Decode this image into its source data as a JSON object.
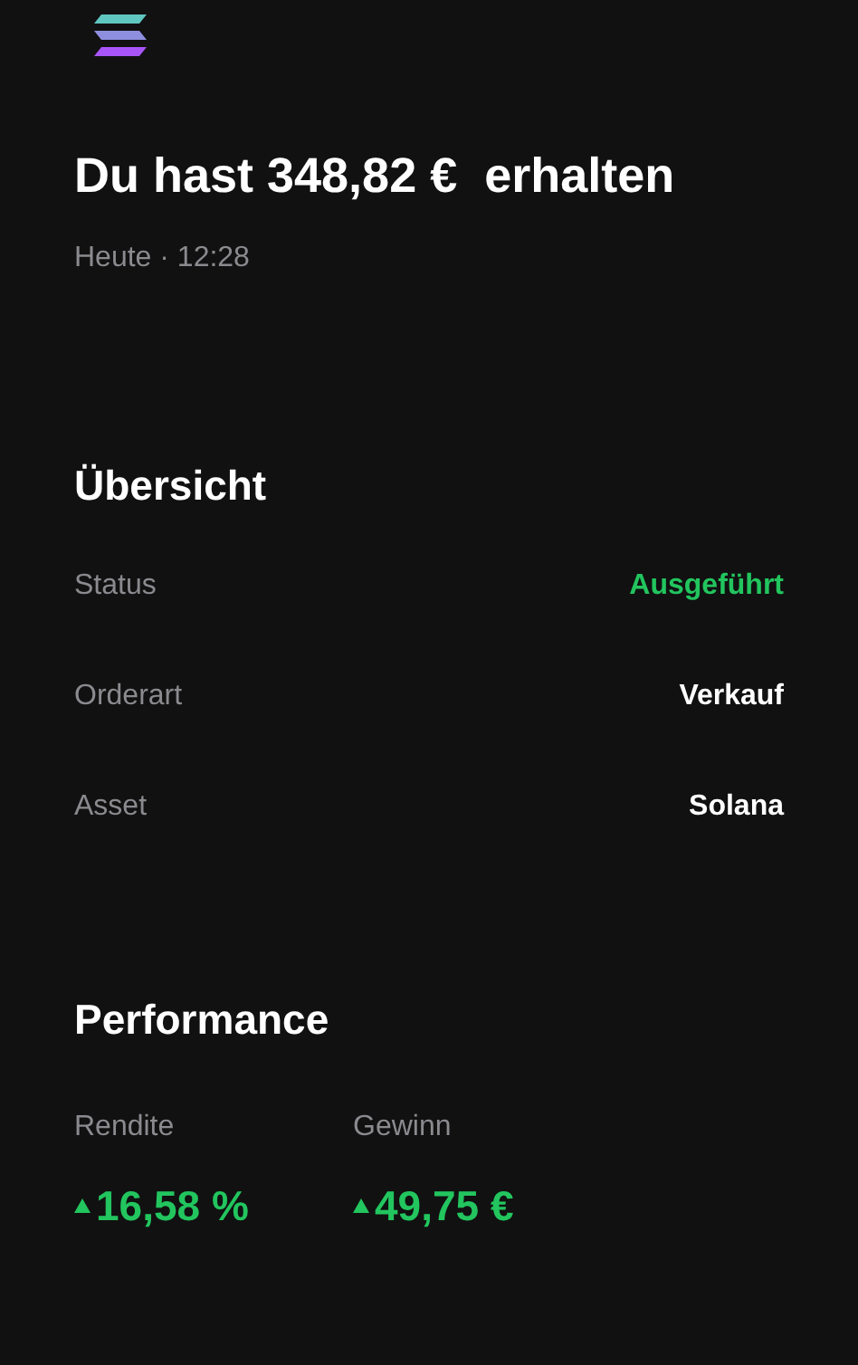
{
  "header": {
    "title": "Du hast 348,82 €  erhalten",
    "subtitle": "Heute · 12:28"
  },
  "overview": {
    "title": "Übersicht",
    "rows": [
      {
        "label": "Status",
        "value": "Ausgeführt",
        "kind": "status"
      },
      {
        "label": "Orderart",
        "value": "Verkauf",
        "kind": "plain"
      },
      {
        "label": "Asset",
        "value": "Solana",
        "kind": "plain"
      }
    ]
  },
  "performance": {
    "title": "Performance",
    "metrics": [
      {
        "label": "Rendite",
        "value": "16,58 %",
        "kind": "gain"
      },
      {
        "label": "Gewinn",
        "value": "49,75 €",
        "kind": "gain"
      }
    ]
  }
}
